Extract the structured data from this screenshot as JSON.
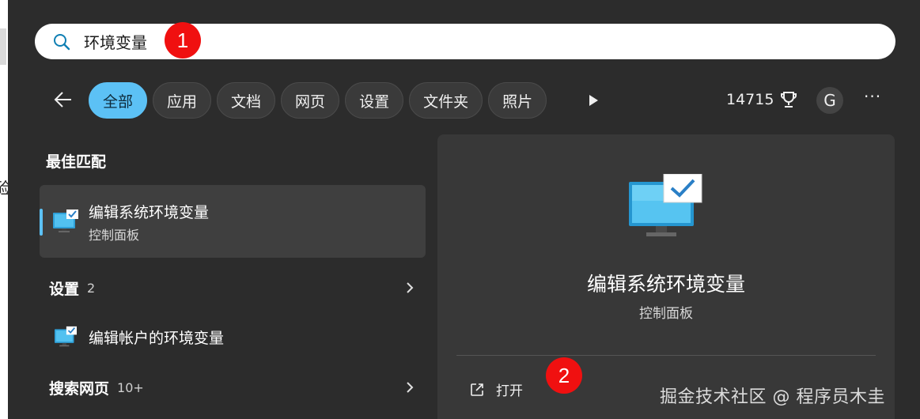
{
  "search": {
    "value": "环境变量",
    "placeholder": ""
  },
  "annotations": {
    "badge_1": "1",
    "badge_2": "2"
  },
  "filters": [
    {
      "label": "全部",
      "active": true
    },
    {
      "label": "应用",
      "active": false
    },
    {
      "label": "文档",
      "active": false
    },
    {
      "label": "网页",
      "active": false
    },
    {
      "label": "设置",
      "active": false
    },
    {
      "label": "文件夹",
      "active": false
    },
    {
      "label": "照片",
      "active": false
    }
  ],
  "header": {
    "points": "14715",
    "avatar_initial": "G",
    "more": "···"
  },
  "left": {
    "best_match_title": "最佳匹配",
    "best_match": {
      "title": "编辑系统环境变量",
      "subtitle": "控制面板"
    },
    "settings_label": "设置",
    "settings_count": "2",
    "env_item_label": "编辑帐户的环境变量",
    "web_label": "搜索网页",
    "web_count": "10+"
  },
  "preview": {
    "title": "编辑系统环境变量",
    "subtitle": "控制面板",
    "open_label": "打开"
  },
  "watermark": "掘金技术社区 @ 程序员木圭",
  "colors": {
    "accent": "#5cc1f5",
    "badge": "#f01010",
    "panel": "#2c2c2c"
  }
}
